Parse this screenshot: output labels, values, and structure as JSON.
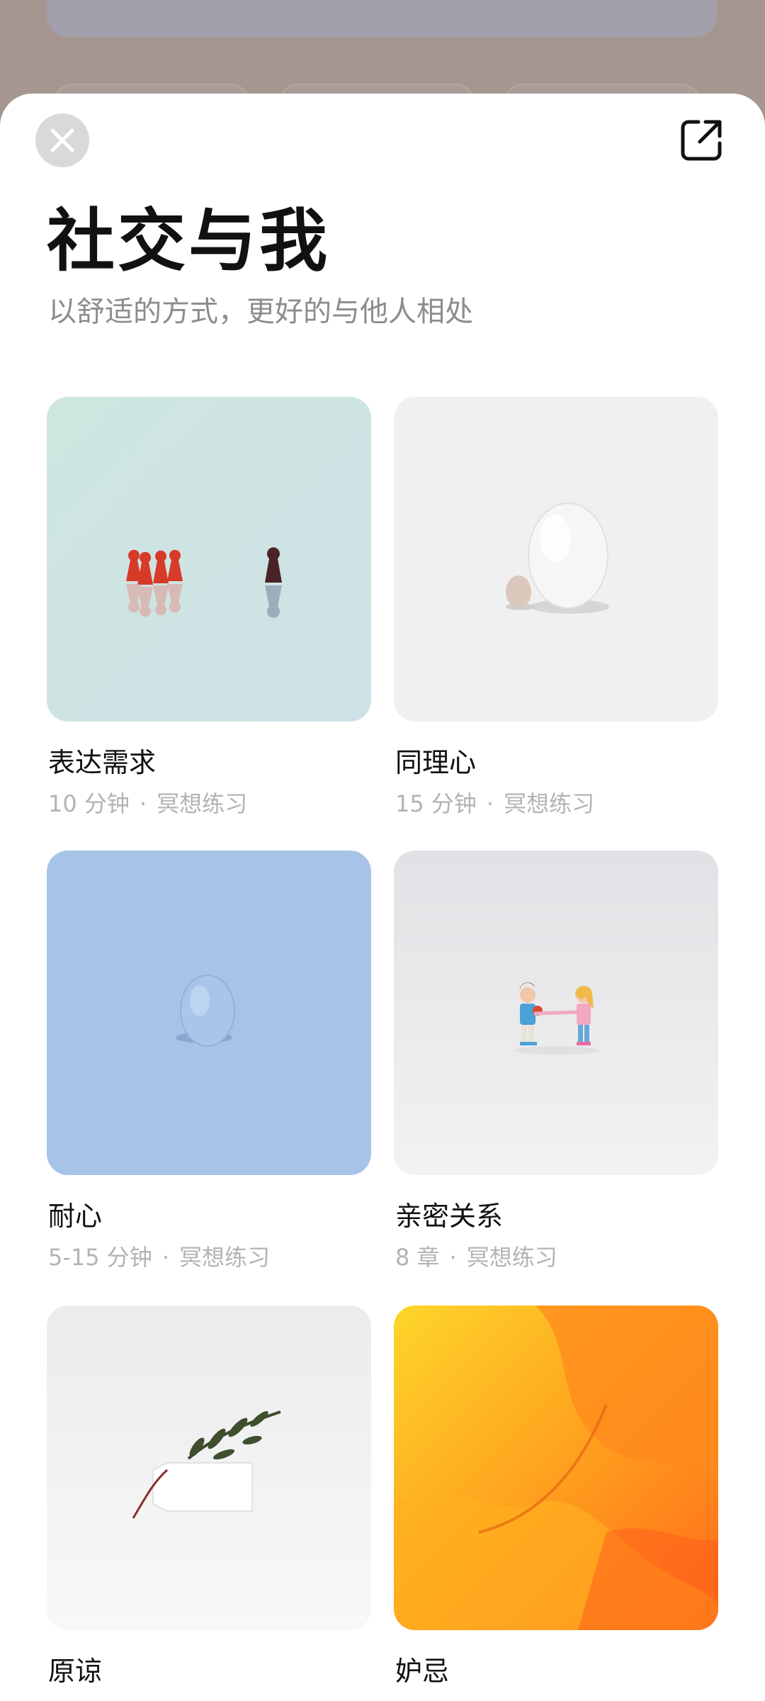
{
  "header": {
    "title": "社交与我",
    "subtitle": "以舒适的方式，更好的与他人相处",
    "close_icon": "close-icon",
    "share_icon": "external-link-icon"
  },
  "cards": [
    {
      "title": "表达需求",
      "duration": "10 分钟",
      "type": "冥想练习",
      "bg": "#cfe6df"
    },
    {
      "title": "同理心",
      "duration": "15 分钟",
      "type": "冥想练习",
      "bg": "#f0f0f0"
    },
    {
      "title": "耐心",
      "duration": "5-15 分钟",
      "type": "冥想练习",
      "bg": "#a7c4e8"
    },
    {
      "title": "亲密关系",
      "duration": "8 章",
      "type": "冥想练习",
      "bg": "#e6e6e8"
    },
    {
      "title": "原谅",
      "duration": "",
      "type": "",
      "bg": "#f2f2f2"
    },
    {
      "title": "妒忌",
      "duration": "",
      "type": "",
      "bg": "#fdd62a"
    }
  ],
  "colors": {
    "accent_orange": "#ff8a1c",
    "text_primary": "#111111",
    "text_secondary": "#8c8c8c"
  }
}
